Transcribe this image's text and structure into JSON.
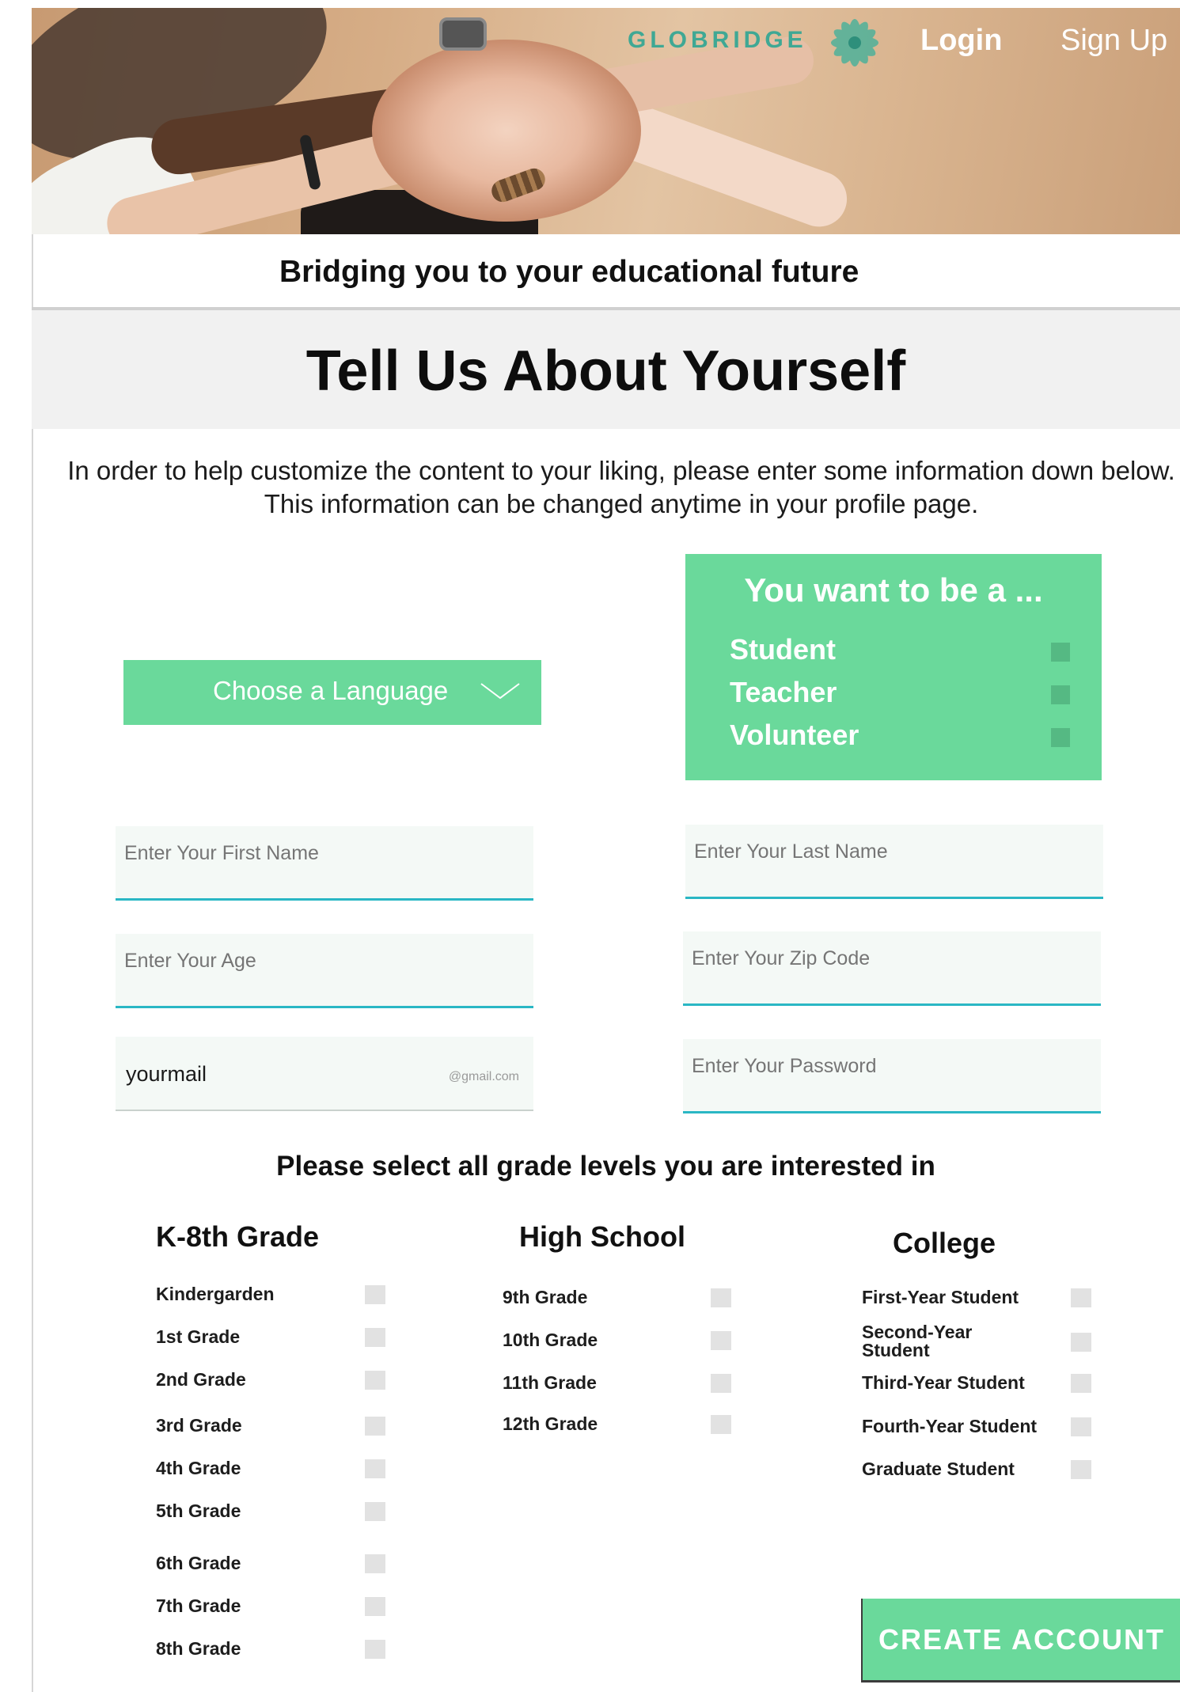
{
  "header": {
    "brand": "GLOBRIDGE",
    "logo_icon": "flower-logo-icon",
    "login_label": "Login",
    "signup_label": "Sign Up",
    "hero_image": "team-stacked-hands-photo"
  },
  "tagline": "Bridging you to your educational  future",
  "page_title": "Tell Us About Yourself",
  "intro_text": "In order to help customize the content to your liking, please enter some information down below.  This information can be changed anytime in your profile page.",
  "language_dropdown": {
    "label": "Choose a Language",
    "icon": "chevron-down-icon"
  },
  "role_box": {
    "title": "You want to be a ...",
    "options": [
      "Student",
      "Teacher",
      "Volunteer"
    ]
  },
  "form": {
    "first_name_placeholder": "Enter Your First Name",
    "last_name_placeholder": "Enter Your Last Name",
    "age_placeholder": "Enter Your Age",
    "zip_placeholder": "Enter Your Zip Code",
    "email_value": "yourmail",
    "email_suffix": "@gmail.com",
    "password_placeholder": "Enter Your Password"
  },
  "grade_prompt": "Please select all grade levels you are interested in",
  "grades": {
    "k8": {
      "heading": "K-8th Grade",
      "items": [
        "Kindergarden",
        "1st Grade",
        "2nd Grade",
        "3rd Grade",
        "4th Grade",
        "5th Grade",
        "6th Grade",
        "7th Grade",
        "8th Grade"
      ]
    },
    "high_school": {
      "heading": "High School",
      "items": [
        "9th Grade",
        "10th Grade",
        "11th Grade",
        "12th Grade"
      ]
    },
    "college": {
      "heading": "College",
      "items": [
        "First-Year Student",
        "Second-Year Student",
        "Third-Year Student",
        "Fourth-Year Student",
        "Graduate Student"
      ]
    }
  },
  "create_button": "CREATE ACCOUNT",
  "colors": {
    "accent_green": "#6ad99b",
    "brand_teal": "#3fa894",
    "input_underline": "#2ab7c4"
  }
}
